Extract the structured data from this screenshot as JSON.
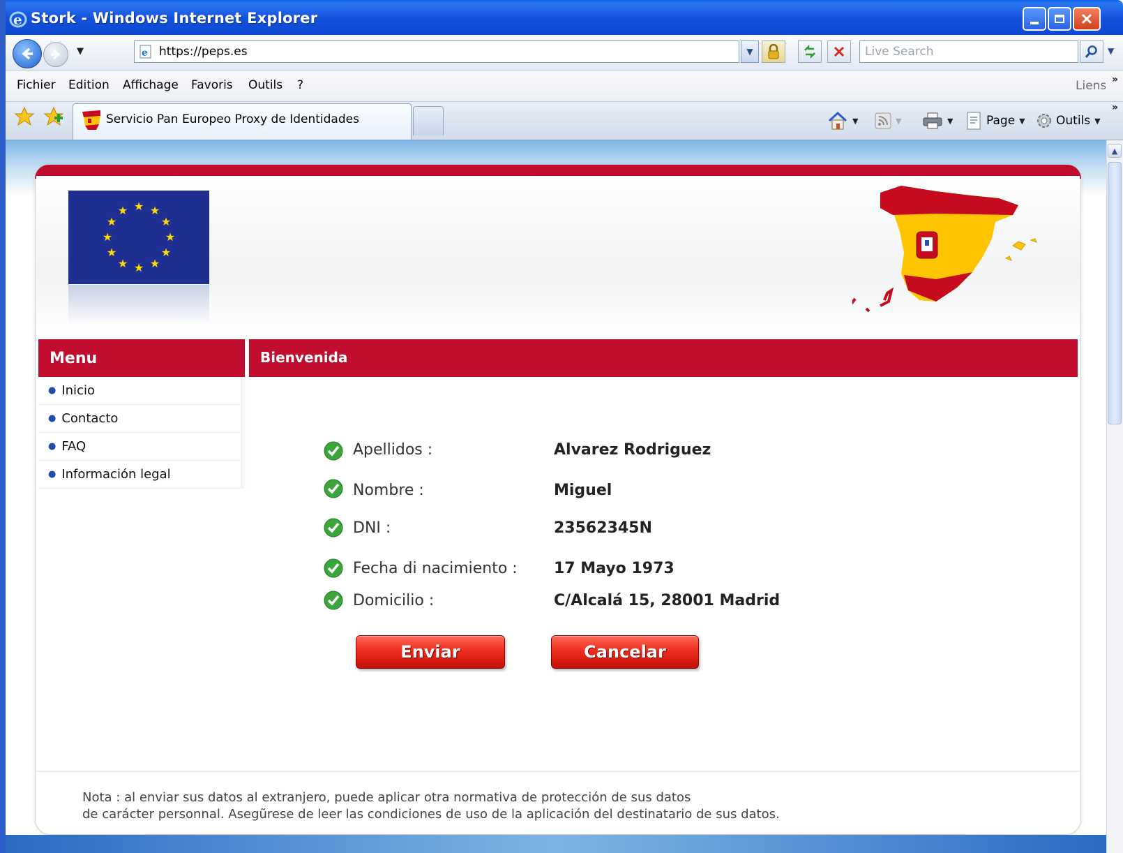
{
  "window": {
    "title": "Stork - Windows Internet Explorer"
  },
  "address": {
    "url": "https://peps.es"
  },
  "search": {
    "placeholder": "Live Search"
  },
  "menubar": {
    "items": [
      "Fichier",
      "Edition",
      "Affichage",
      "Favoris",
      "Outils",
      "?"
    ],
    "links_label": "Liens"
  },
  "tab": {
    "title": "Servicio Pan Europeo Proxy de Identidades"
  },
  "commandbar": {
    "page_label": "Page",
    "tools_label": "Outils"
  },
  "page": {
    "menu_title": "Menu",
    "menu_items": [
      "Inicio",
      "Contacto",
      "FAQ",
      "Información legal"
    ],
    "section_title": "Bienvenida",
    "fields": [
      {
        "label": "Apellidos :",
        "value": "Alvarez Rodriguez"
      },
      {
        "label": "Nombre :",
        "value": "Miguel"
      },
      {
        "label": "DNI :",
        "value": "23562345N"
      },
      {
        "label": "Fecha di nacimiento :",
        "value": "17 Mayo 1973"
      },
      {
        "label": "Domicilio :",
        "value": "C/Alcalá 15, 28001 Madrid"
      }
    ],
    "submit_label": "Enviar",
    "cancel_label": "Cancelar",
    "note_line1": "Nota : al enviar sus datos al extranjero, puede aplicar otra normativa de protección de sus datos",
    "note_line2": "de carácter personnal. Asegũrese de leer las condiciones de uso de la aplicación del destinatario de sus datos."
  },
  "colors": {
    "brand_red": "#c10d2e",
    "button_red": "#f02d1e",
    "xp_blue": "#0b47cf"
  },
  "icons": [
    "ie-logo-icon",
    "back-arrow-icon",
    "forward-arrow-icon",
    "page-icon",
    "lock-icon",
    "refresh-icon",
    "stop-icon",
    "search-icon",
    "favorites-star-icon",
    "add-favorite-icon",
    "home-icon",
    "rss-icon",
    "print-icon",
    "page-menu-icon",
    "tools-gear-icon",
    "check-icon"
  ]
}
